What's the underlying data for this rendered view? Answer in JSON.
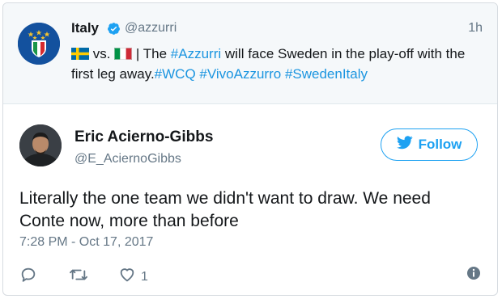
{
  "quoted_tweet": {
    "name": "Italy",
    "handle": "@azzurri",
    "time": "1h",
    "vs_text": "vs.",
    "text_pre": " | The ",
    "tag_azzurri": "#Azzurri",
    "text_mid": " will face Sweden in the play-off with the first leg away.",
    "tag_wcq": "#WCQ",
    "tag_vivo": "#VivoAzzurro",
    "tag_swedenitaly": "#SwedenItaly"
  },
  "tweet": {
    "name": "Eric Acierno-Gibbs",
    "handle": "@E_AciernoGibbs",
    "text": "Literally the one team we didn't want to draw. We need Conte now, more than before",
    "date": "7:28 PM - Oct 17, 2017",
    "follow_label": "Follow",
    "like_count": "1"
  },
  "icons": {
    "verified": "verified-badge-icon",
    "follow": "twitter-bird-icon",
    "reply": "reply-icon",
    "retweet": "retweet-icon",
    "like": "heart-icon",
    "info": "info-icon"
  },
  "colors": {
    "link": "#1b95e0",
    "accent": "#1da1f2",
    "muted": "#657786",
    "quoted_bg": "#f5f8fa"
  }
}
